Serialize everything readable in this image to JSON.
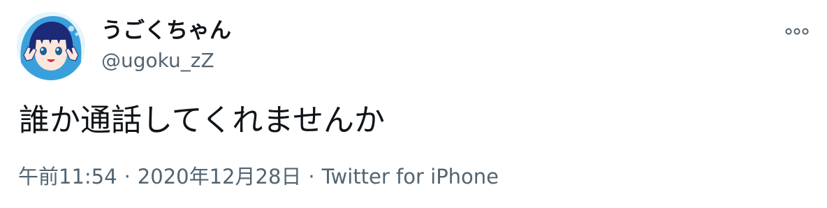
{
  "user": {
    "display_name": "うごくちゃん",
    "handle": "@ugoku_zZ"
  },
  "tweet": {
    "text": "誰か通話してくれませんか",
    "time": "午前11:54",
    "date": "2020年12月28日",
    "separator": "·",
    "source": "Twitter for iPhone"
  },
  "icons": {
    "more": "more-horizontal-icon",
    "avatar": "user-avatar"
  },
  "colors": {
    "primary_text": "#0f1419",
    "secondary_text": "#536471",
    "avatar_background": "#e6f4fb",
    "avatar_hair": "#1d2a78",
    "avatar_hoodie": "#3aa0dc"
  }
}
